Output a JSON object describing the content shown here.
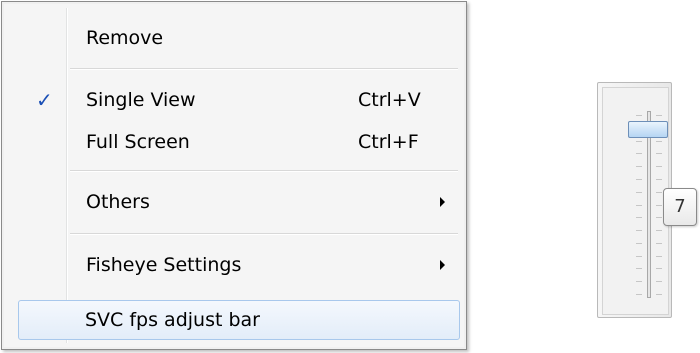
{
  "context_menu": {
    "items": [
      {
        "label": "Remove",
        "shortcut": "",
        "checked": false,
        "submenu": false
      },
      {
        "label": "Single View",
        "shortcut": "Ctrl+V",
        "checked": true,
        "submenu": false
      },
      {
        "label": "Full Screen",
        "shortcut": "Ctrl+F",
        "checked": false,
        "submenu": false
      },
      {
        "label": "Others",
        "shortcut": "",
        "checked": false,
        "submenu": true
      },
      {
        "label": "Fisheye Settings",
        "shortcut": "",
        "checked": false,
        "submenu": true
      },
      {
        "label": "SVC fps adjust bar",
        "shortcut": "",
        "checked": false,
        "submenu": false,
        "highlighted": true
      }
    ],
    "check_glyph": "✓"
  },
  "fps_slider": {
    "value": "7",
    "level_fraction": 0.9,
    "icons": {
      "thumb": "slider-thumb",
      "track": "slider-track"
    }
  },
  "colors": {
    "check": "#1a4fb5",
    "highlight_border": "#a8c8ec",
    "thumb": "#b5d5f3"
  }
}
